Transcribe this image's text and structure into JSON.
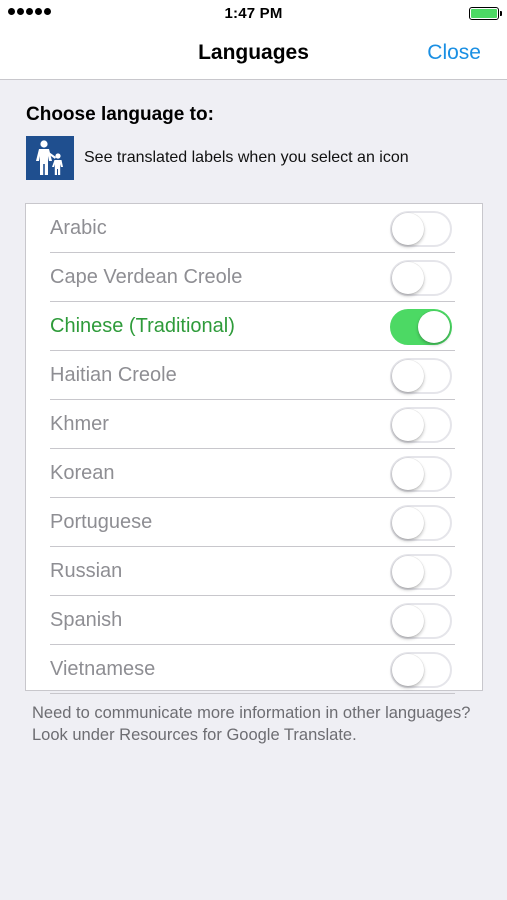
{
  "status_bar": {
    "time": "1:47 PM",
    "signal_icon": "signal-dots-icon",
    "battery_icon": "battery-icon",
    "battery_color": "#4cd964"
  },
  "nav": {
    "title": "Languages",
    "close_label": "Close",
    "accent_color": "#1a8fe3"
  },
  "section": {
    "heading": "Choose language to:",
    "info_icon": "family-icon",
    "info_text": "See translated labels when you select an icon"
  },
  "languages": [
    {
      "label": "Arabic",
      "enabled": false
    },
    {
      "label": "Cape Verdean Creole",
      "enabled": false
    },
    {
      "label": "Chinese (Traditional)",
      "enabled": true
    },
    {
      "label": "Haitian Creole",
      "enabled": false
    },
    {
      "label": "Khmer",
      "enabled": false
    },
    {
      "label": "Korean",
      "enabled": false
    },
    {
      "label": "Portuguese",
      "enabled": false
    },
    {
      "label": "Russian",
      "enabled": false
    },
    {
      "label": "Spanish",
      "enabled": false
    },
    {
      "label": "Vietnamese",
      "enabled": false
    }
  ],
  "selected_color": "#2e9b3a",
  "toggle_on_color": "#4cd964",
  "footer": {
    "note": "Need to communicate more information in other languages? Look under Resources for Google Translate."
  }
}
